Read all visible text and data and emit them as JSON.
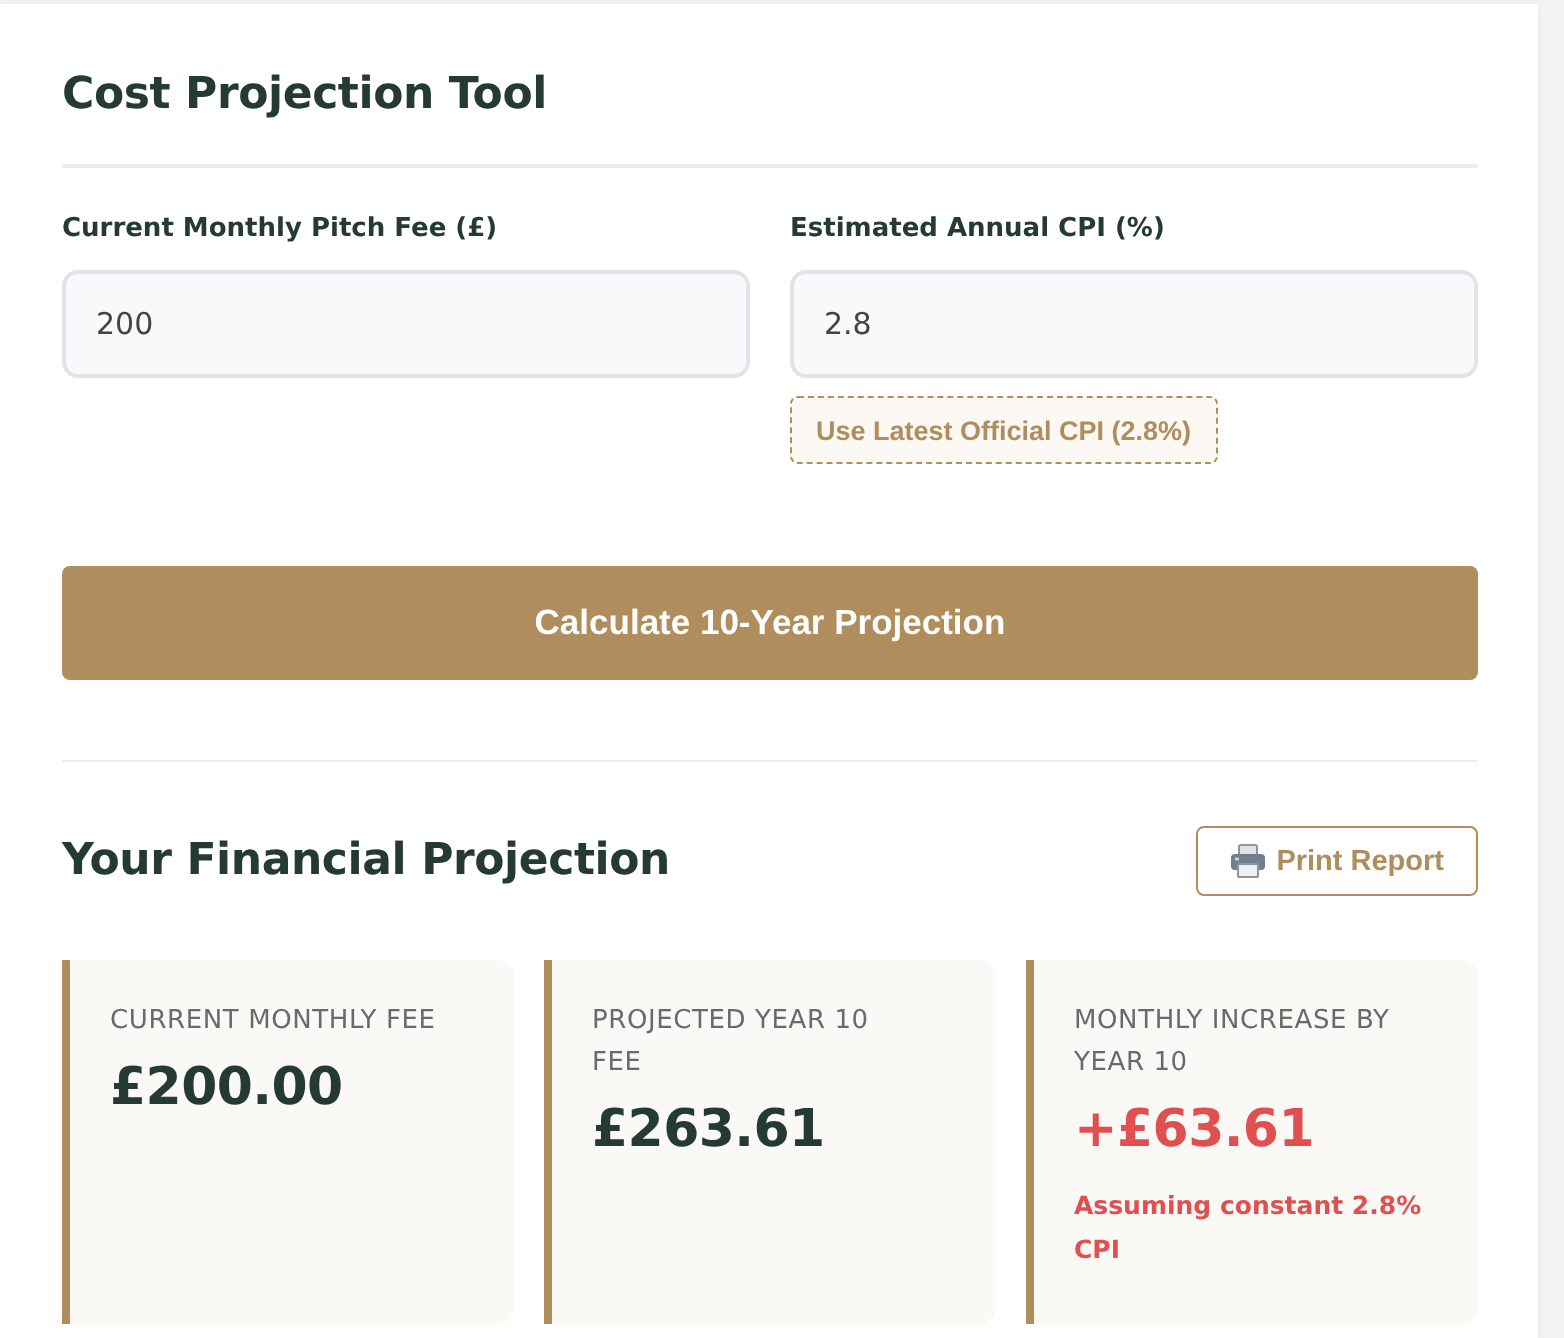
{
  "title": "Cost Projection Tool",
  "fields": [
    {
      "label": "Current Monthly Pitch Fee (£)",
      "value": "200"
    },
    {
      "label": "Estimated Annual CPI (%)",
      "value": "2.8",
      "suggestion": "Use Latest Official CPI (2.8%)"
    }
  ],
  "calculate_button": "Calculate 10-Year Projection",
  "results": {
    "title": "Your Financial Projection",
    "print_button": "Print Report",
    "cards": [
      {
        "kind": "amount",
        "label": "CURRENT MONTHLY FEE",
        "value": "£200.00"
      },
      {
        "kind": "amount",
        "label": "PROJECTED YEAR 10 FEE",
        "value": "£263.61"
      },
      {
        "kind": "increase",
        "label": "MONTHLY INCREASE BY YEAR 10",
        "value": "+£63.61",
        "note": "Assuming constant 2.8% CPI"
      }
    ]
  }
}
